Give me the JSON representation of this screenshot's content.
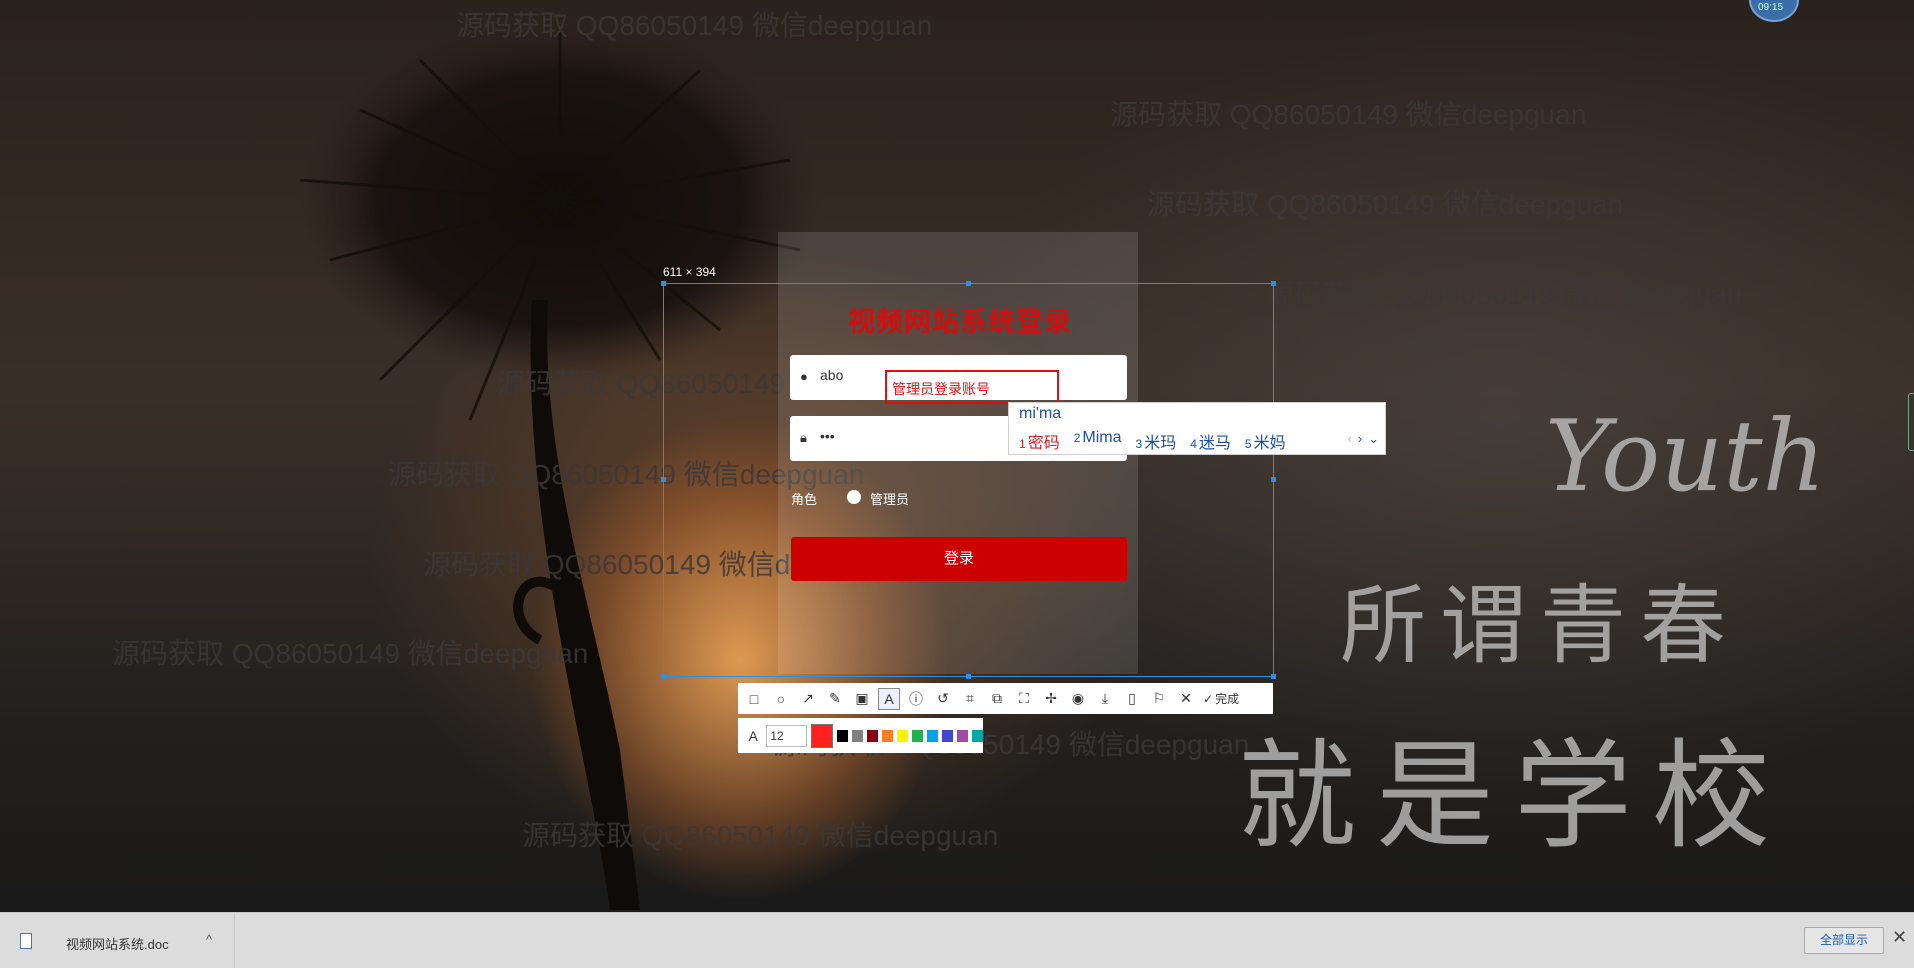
{
  "watermark": "源码获取 QQ86050149 微信deepguan",
  "avatar_time": "09:15",
  "selection": {
    "dimensions": "611 × 394"
  },
  "login": {
    "title": "视频网站系统登录",
    "username_value": "abo",
    "username_hint": "管理员登录账号",
    "password_value": "•••",
    "role_label": "角色",
    "role_option": "管理员",
    "login_button": "登录"
  },
  "ime": {
    "input": "mi'ma",
    "candidates": [
      {
        "n": "1",
        "text": "密码"
      },
      {
        "n": "2",
        "text": "Mima"
      },
      {
        "n": "3",
        "text": "米玛"
      },
      {
        "n": "4",
        "text": "迷马"
      },
      {
        "n": "5",
        "text": "米妈"
      }
    ]
  },
  "toolbar": {
    "done_label": "完成",
    "font_size": "12"
  },
  "art": {
    "youth": "Youth",
    "line1": "所谓青春",
    "line2": "就是学校"
  },
  "downloads": {
    "file_name": "视频网站系统.doc",
    "show_all": "全部显示"
  },
  "colors": {
    "accent": "#cc0000",
    "selection": "#2a90e8",
    "palette": [
      "#ff2020",
      "#000000",
      "#7f7f7f",
      "#880015",
      "#ed1c24",
      "#ff7f27",
      "#fff200",
      "#22b14c",
      "#00a2e8",
      "#3f48cc",
      "#a349a4",
      "#ffaec9",
      "#00a8a8"
    ]
  }
}
